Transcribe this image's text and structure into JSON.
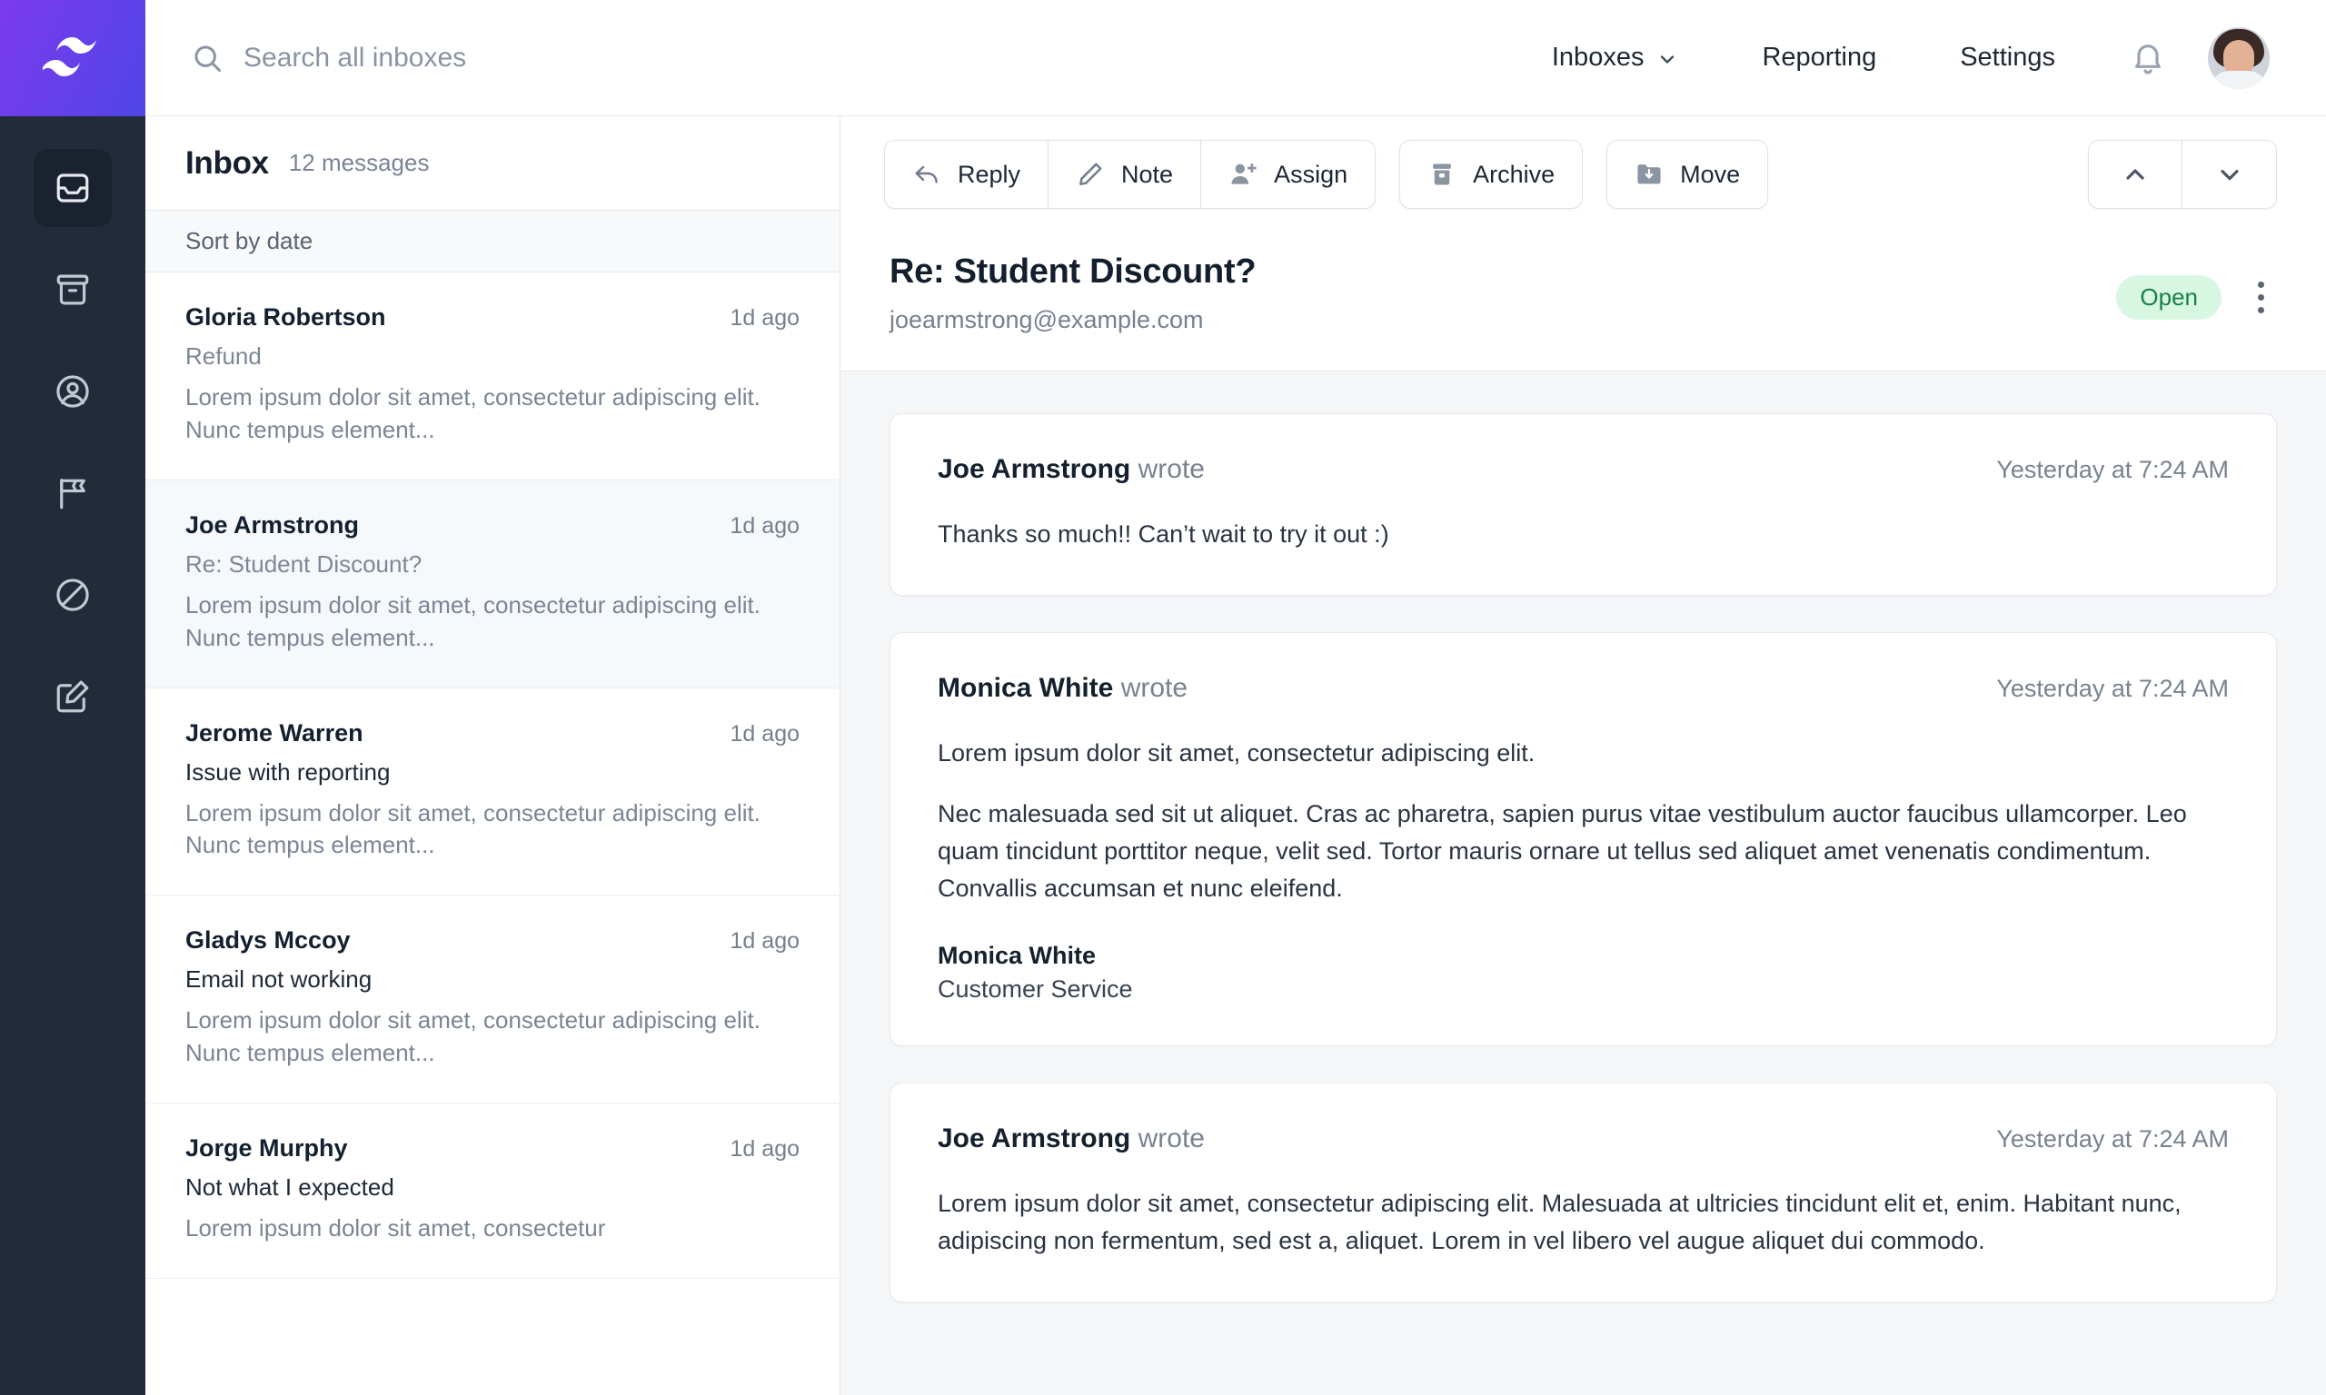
{
  "brand": {
    "logo_icon": "wave-logo-icon",
    "gradient_from": "#7c3aed",
    "gradient_to": "#4f46e5"
  },
  "rail": {
    "items": [
      {
        "name": "inbox",
        "icon": "inbox-icon",
        "active": true
      },
      {
        "name": "archive",
        "icon": "archive-icon",
        "active": false
      },
      {
        "name": "contacts",
        "icon": "user-circle-icon",
        "active": false
      },
      {
        "name": "flagged",
        "icon": "flag-icon",
        "active": false
      },
      {
        "name": "spam",
        "icon": "ban-icon",
        "active": false
      },
      {
        "name": "compose",
        "icon": "compose-icon",
        "active": false
      }
    ]
  },
  "topbar": {
    "search": {
      "icon": "search-icon",
      "value": "",
      "placeholder": "Search all inboxes"
    },
    "nav": [
      {
        "label": "Inboxes",
        "has_caret": true
      },
      {
        "label": "Reporting",
        "has_caret": false
      },
      {
        "label": "Settings",
        "has_caret": false
      }
    ],
    "bell_icon": "bell-icon",
    "avatar": "user-avatar"
  },
  "list": {
    "title": "Inbox",
    "count_label": "12 messages",
    "sort_label": "Sort by date",
    "rows": [
      {
        "name": "Gloria Robertson",
        "time": "1d ago",
        "subject": "Refund",
        "read": true,
        "snippet": "Lorem ipsum dolor sit amet, consectetur adipiscing elit. Nunc tempus element...",
        "selected": false
      },
      {
        "name": "Joe Armstrong",
        "time": "1d ago",
        "subject": "Re: Student Discount?",
        "read": true,
        "snippet": "Lorem ipsum dolor sit amet, consectetur adipiscing elit. Nunc tempus element...",
        "selected": true
      },
      {
        "name": "Jerome Warren",
        "time": "1d ago",
        "subject": "Issue with reporting",
        "read": false,
        "snippet": "Lorem ipsum dolor sit amet, consectetur adipiscing elit. Nunc tempus element...",
        "selected": false
      },
      {
        "name": "Gladys Mccoy",
        "time": "1d ago",
        "subject": "Email not working",
        "read": false,
        "snippet": "Lorem ipsum dolor sit amet, consectetur adipiscing elit. Nunc tempus element...",
        "selected": false
      },
      {
        "name": "Jorge Murphy",
        "time": "1d ago",
        "subject": "Not what I expected",
        "read": false,
        "snippet": "Lorem ipsum dolor sit amet, consectetur",
        "selected": false
      }
    ]
  },
  "toolbar": {
    "group": [
      {
        "label": "Reply",
        "icon": "reply-arrow-icon"
      },
      {
        "label": "Note",
        "icon": "pencil-icon"
      },
      {
        "label": "Assign",
        "icon": "person-plus-icon"
      }
    ],
    "archive": {
      "label": "Archive",
      "icon": "archive-box-icon"
    },
    "move": {
      "label": "Move",
      "icon": "folder-move-icon"
    },
    "prev_icon": "chevron-up-icon",
    "next_icon": "chevron-down-icon"
  },
  "conversation": {
    "subject": "Re: Student Discount?",
    "email": "joearmstrong@example.com",
    "status_badge": "Open",
    "status_badge_color": "#1a7f46",
    "status_badge_bg": "#d7f7e2",
    "more_icon": "kebab-menu-icon",
    "messages": [
      {
        "author": "Joe Armstrong",
        "wrote_label": "wrote",
        "time": "Yesterday at 7:24 AM",
        "paragraphs": [
          "Thanks so much!! Can’t wait to try it out :)"
        ],
        "signature": null
      },
      {
        "author": "Monica White",
        "wrote_label": "wrote",
        "time": "Yesterday at 7:24 AM",
        "paragraphs": [
          "Lorem ipsum dolor sit amet, consectetur adipiscing elit.",
          "Nec malesuada sed sit ut aliquet. Cras ac pharetra, sapien purus vitae vestibulum auctor faucibus ullamcorper. Leo quam tincidunt porttitor neque, velit sed. Tortor mauris ornare ut tellus sed aliquet amet venenatis condimentum. Convallis accumsan et nunc eleifend."
        ],
        "signature": {
          "name": "Monica White",
          "role": "Customer Service"
        }
      },
      {
        "author": "Joe Armstrong",
        "wrote_label": "wrote",
        "time": "Yesterday at 7:24 AM",
        "paragraphs": [
          "Lorem ipsum dolor sit amet, consectetur adipiscing elit. Malesuada at ultricies tincidunt elit et, enim. Habitant nunc, adipiscing non fermentum, sed est a, aliquet. Lorem in vel libero vel augue aliquet dui commodo."
        ],
        "signature": null
      }
    ]
  }
}
